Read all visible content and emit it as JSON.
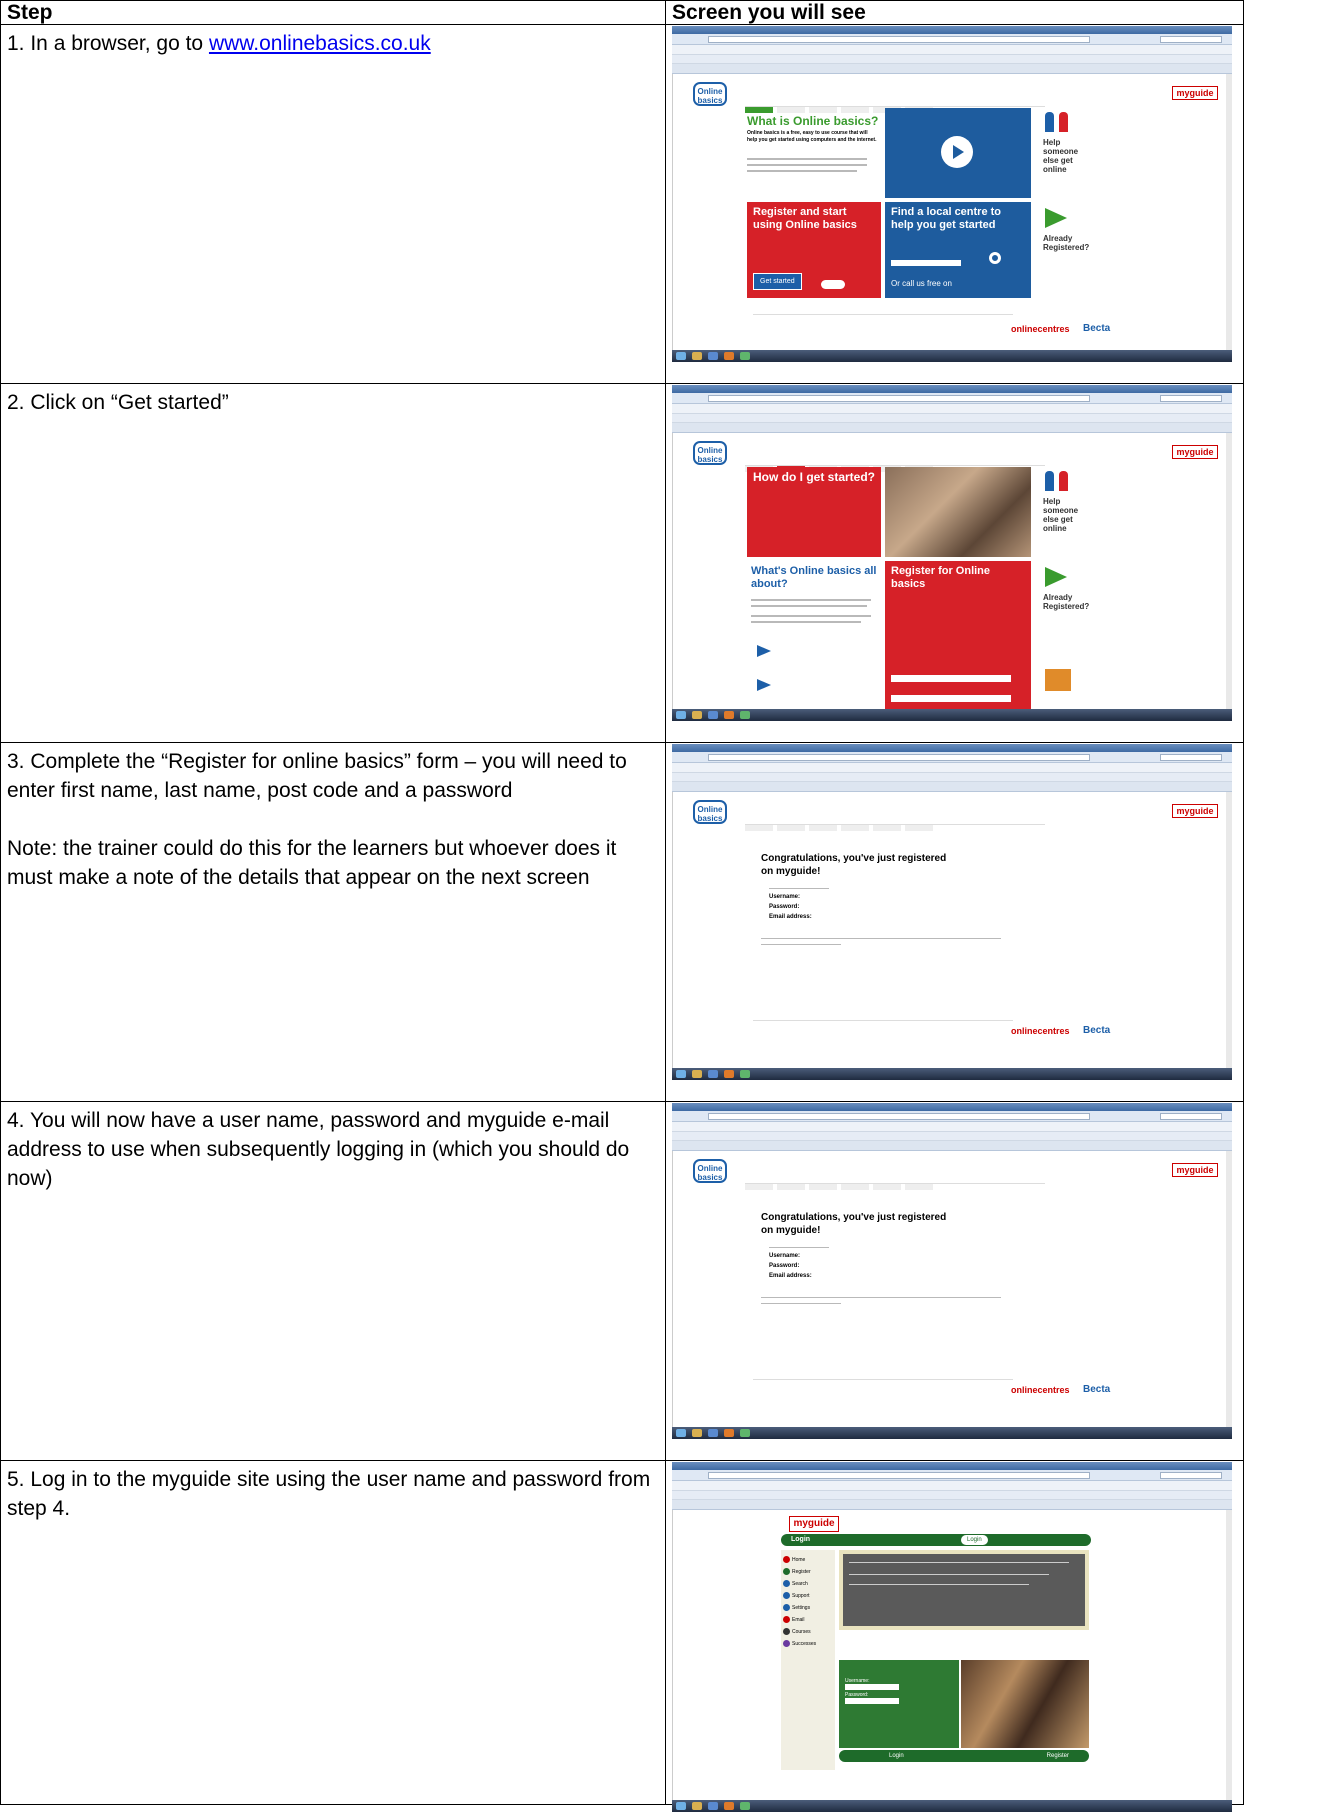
{
  "table": {
    "header_step": "Step",
    "header_screen": "Screen you will see"
  },
  "steps": [
    {
      "text_before_link": "1. In a browser, go to ",
      "link": "www.onlinebasics.co.uk"
    },
    {
      "text": "2. Click on “Get started”"
    },
    {
      "text": "3. Complete the “Register for online basics” form – you will need to enter first name, last name, post code and a password",
      "note": "Note: the trainer could do this for the learners but whoever does it must make a note of the details that appear on the next screen"
    },
    {
      "text": "4. You will now have a user name, password and myguide e-mail address to use when subsequently logging in (which you should do now)"
    },
    {
      "text": "5. Log in to the myguide site using the user name and password from step 4."
    }
  ],
  "screens": {
    "s1": {
      "logo": "Online basics",
      "myguide": "myguide",
      "title": "What is Online basics?",
      "intro": "Online basics is a free, easy to use course that will help you get started using computers and the internet.",
      "help_title": "Help someone else get online",
      "register_title": "Register and start using Online basics",
      "register_button": "Get started",
      "find_title": "Find a local centre to help you get started",
      "call": "Or call us free on",
      "already": "Already Registered?",
      "footer_brand": "onlinecentres",
      "footer_brand2": "Becta"
    },
    "s2": {
      "title": "How do I get started?",
      "help_title": "Help someone else get online",
      "about_title": "What's Online basics all about?",
      "register_title": "Register for Online basics",
      "already": "Already Registered?"
    },
    "s3": {
      "heading": "Congratulations, you've just registered on myguide!",
      "username_label": "Username:",
      "password_label": "Password:",
      "email_label": "Email address:",
      "footer_brand": "onlinecentres",
      "footer_brand2": "Becta"
    },
    "s4": {
      "heading": "Congratulations, you've just registered on myguide!",
      "username_label": "Username:",
      "password_label": "Password:",
      "email_label": "Email address:",
      "footer_brand": "onlinecentres",
      "footer_brand2": "Becta"
    },
    "s5": {
      "myguide": "myguide",
      "login_title": "Login",
      "login_button": "Login",
      "menu": [
        "Home",
        "Register",
        "Search",
        "Support",
        "Settings",
        "Email",
        "Courses",
        "Successes"
      ],
      "username_label": "Username:",
      "password_label": "Password:",
      "bottom_login": "Login",
      "bottom_register": "Register"
    }
  },
  "colors": {
    "green": "#3a9b2e",
    "red": "#d62128",
    "blue": "#1d5fa8",
    "myguide_green": "#1e6b2a"
  }
}
